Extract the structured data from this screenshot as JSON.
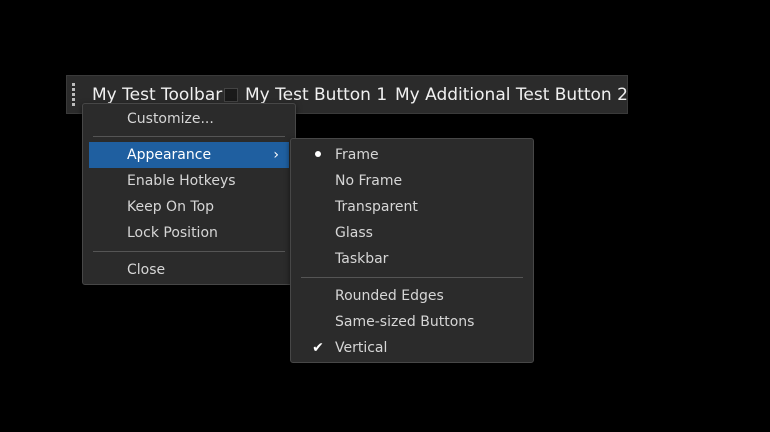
{
  "toolbar": {
    "title": "My Test Toolbar",
    "buttons": [
      "My Test Button 1",
      "My Additional Test Button 2"
    ]
  },
  "context_menu": {
    "customize": "Customize...",
    "appearance": "Appearance",
    "enable_hotkeys": "Enable Hotkeys",
    "keep_on_top": "Keep On Top",
    "lock_position": "Lock Position",
    "close": "Close"
  },
  "appearance_menu": {
    "frame": "Frame",
    "no_frame": "No Frame",
    "transparent": "Transparent",
    "glass": "Glass",
    "taskbar": "Taskbar",
    "rounded_edges": "Rounded Edges",
    "same_sized_buttons": "Same-sized Buttons",
    "vertical": "Vertical",
    "selected_style": "Frame",
    "checked_options": [
      "Vertical"
    ]
  },
  "icons": {
    "chevron": "chevron-right-icon",
    "radio": "radio-dot-icon",
    "check": "checkmark-icon"
  },
  "colors": {
    "background": "#000000",
    "menu_background": "#2b2b2b",
    "highlight": "#1f5fa0"
  }
}
